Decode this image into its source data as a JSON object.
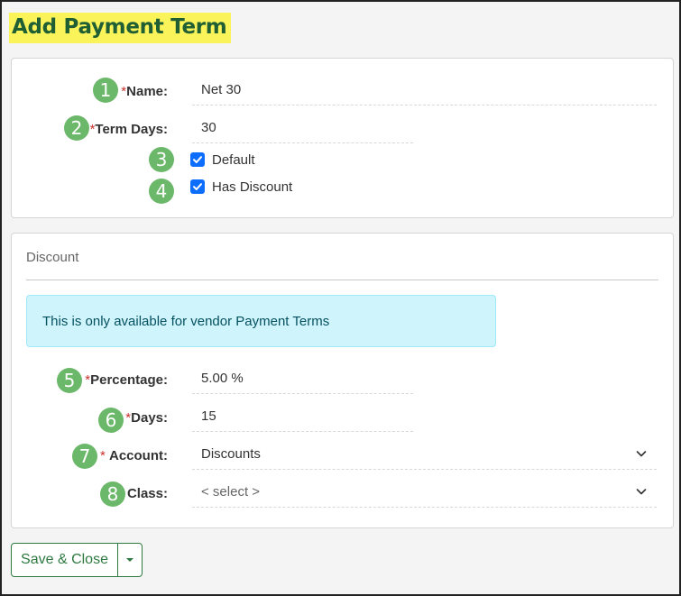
{
  "page": {
    "title": "Add Payment Term"
  },
  "term": {
    "name": {
      "badge": "1",
      "label": "Name:",
      "value": "Net 30"
    },
    "term_days": {
      "badge": "2",
      "label": "Term Days:",
      "value": "30"
    },
    "default": {
      "badge": "3",
      "label": "Default",
      "checked": true
    },
    "has_discount": {
      "badge": "4",
      "label": "Has Discount",
      "checked": true
    }
  },
  "discount": {
    "section_title": "Discount",
    "alert": "This is only available for vendor Payment Terms",
    "percentage": {
      "badge": "5",
      "label": "Percentage:",
      "value": "5.00 %"
    },
    "days": {
      "badge": "6",
      "label": "Days:",
      "value": "15"
    },
    "account": {
      "badge": "7",
      "label": "Account:",
      "value": "Discounts"
    },
    "class": {
      "badge": "8",
      "label": "Class:",
      "value": "< select >"
    }
  },
  "footer": {
    "save_close_label": "Save & Close"
  },
  "icons": {
    "chevron": "chevron-down-icon",
    "caret": "caret-down-icon",
    "check": "check-icon"
  },
  "colors": {
    "title_highlight": "#fbf35a",
    "title_text": "#1f5f33",
    "badge": "#6cb86a",
    "required": "#c9302c",
    "checkbox": "#0d6efd",
    "alert_bg": "#cff4fc",
    "button_green": "#2f7a40"
  }
}
